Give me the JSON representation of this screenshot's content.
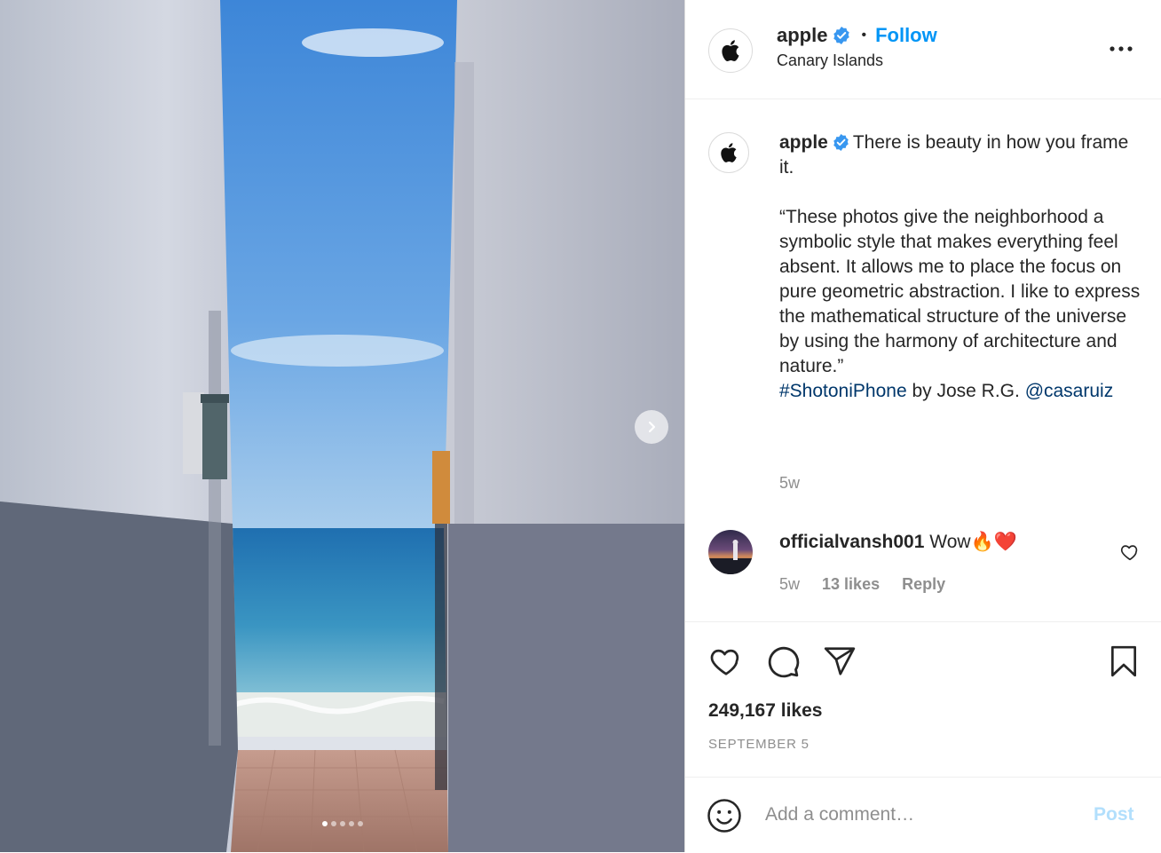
{
  "colors": {
    "accent": "#0095f6",
    "link_dark": "#00376b",
    "muted_text": "#8e8e8e",
    "post_disabled": "#b2dffc",
    "verified": "#3897f0"
  },
  "post": {
    "username": "apple",
    "verified": true,
    "follow_label": "Follow",
    "location": "Canary Islands",
    "carousel": {
      "slide_count": 5,
      "active_slide": 1
    }
  },
  "caption": {
    "username": "apple",
    "line1": "There is beauty in how you frame it.",
    "quote": "“These photos give the neighborhood a symbolic style that makes everything feel absent. It allows me to place the focus on pure geometric abstraction. I like to express the mathematical structure of the universe by using the harmony of architecture and nature.”",
    "hashtag": "#ShotoniPhone",
    "byline": " by Jose R.G. ",
    "mention": "@casaruiz",
    "time": "5w"
  },
  "comments": [
    {
      "username": "officialvansh001",
      "text": "Wow🔥❤️",
      "time": "5w",
      "likes": "13 likes",
      "reply_label": "Reply"
    }
  ],
  "stats": {
    "likes": "249,167 likes",
    "date": "SEPTEMBER 5"
  },
  "comment_box": {
    "placeholder": "Add a comment…",
    "post_label": "Post"
  },
  "icons": {
    "more": "more-horizontal-icon",
    "like": "heart-icon",
    "comment": "comment-bubble-icon",
    "share": "paper-plane-icon",
    "save": "bookmark-icon",
    "emoji": "smiley-icon",
    "next": "chevron-right-icon",
    "verified": "verified-badge-icon"
  }
}
